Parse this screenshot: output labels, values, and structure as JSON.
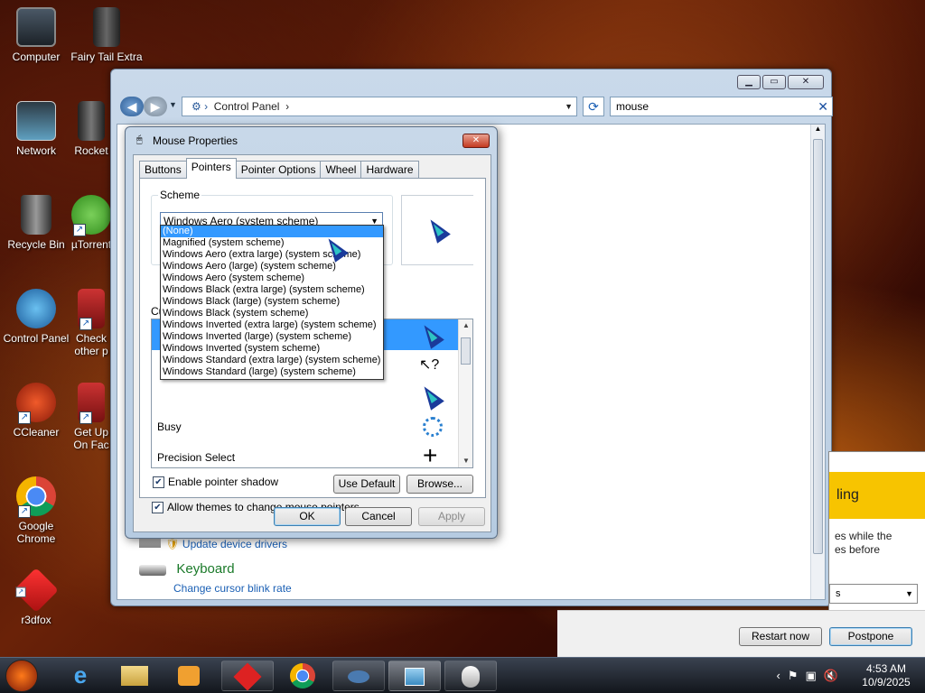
{
  "desktop": {
    "icons": [
      {
        "label": "Computer"
      },
      {
        "label": "Fairy Tail Extra"
      },
      {
        "label": "Network"
      },
      {
        "label": "Rocket"
      },
      {
        "label": "Recycle Bin"
      },
      {
        "label": "µTorrent"
      },
      {
        "label": "Control Panel"
      },
      {
        "label": "Check other p"
      },
      {
        "label": "CCleaner"
      },
      {
        "label": "Get Up On Fac"
      },
      {
        "label": "Google Chrome"
      },
      {
        "label": "r3dfox"
      }
    ]
  },
  "control_panel": {
    "address": "Control Panel",
    "search_value": "mouse",
    "items": {
      "update_drivers": "Update device drivers",
      "keyboard_heading": "Keyboard",
      "cursor_blink": "Change cursor blink rate"
    }
  },
  "dialog": {
    "title": "Mouse Properties",
    "tabs": [
      "Buttons",
      "Pointers",
      "Pointer Options",
      "Wheel",
      "Hardware"
    ],
    "active_tab": "Pointers",
    "scheme_group_label": "Scheme",
    "scheme_selected": "Windows Aero (system scheme)",
    "scheme_options": [
      "(None)",
      "Magnified (system scheme)",
      "Windows Aero (extra large) (system scheme)",
      "Windows Aero (large) (system scheme)",
      "Windows Aero (system scheme)",
      "Windows Black (extra large) (system scheme)",
      "Windows Black (large) (system scheme)",
      "Windows Black (system scheme)",
      "Windows Inverted (extra large) (system scheme)",
      "Windows Inverted (large) (system scheme)",
      "Windows Inverted (system scheme)",
      "Windows Standard (extra large) (system scheme)",
      "Windows Standard (large) (system scheme)"
    ],
    "customize_label": "Cu",
    "cursor_rows": [
      "Busy",
      "Precision Select"
    ],
    "enable_shadow": "Enable pointer shadow",
    "allow_themes": "Allow themes to change mouse pointers",
    "use_default": "Use Default",
    "browse": "Browse...",
    "ok": "OK",
    "cancel": "Cancel",
    "apply": "Apply"
  },
  "update_popup": {
    "banner": "ling",
    "text_line1": "es while the",
    "text_line2": "es before",
    "select_value": "s",
    "restart_now": "Restart now",
    "postpone": "Postpone"
  },
  "taskbar": {
    "time": "4:53 AM",
    "date": "10/9/2025"
  }
}
